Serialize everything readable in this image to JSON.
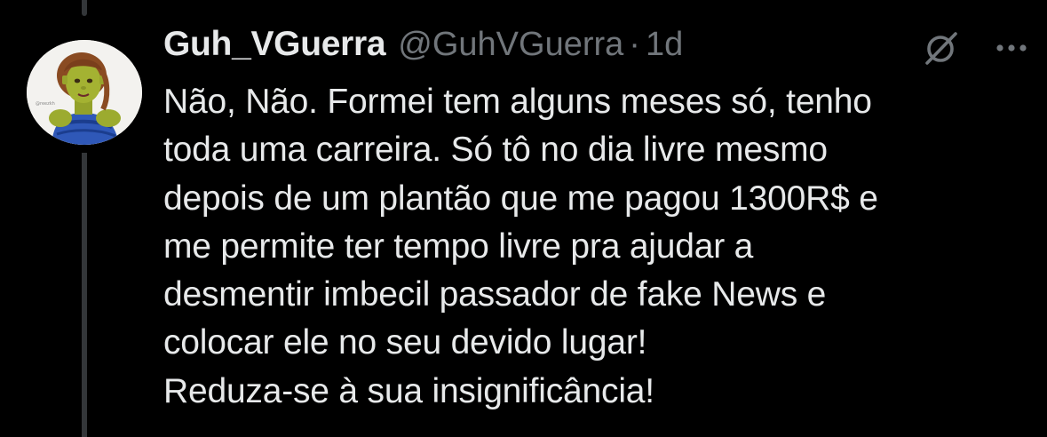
{
  "tweet": {
    "display_name": "Guh_VGuerra",
    "handle": "@GuhVGuerra",
    "separator": "·",
    "time": "1d",
    "lines": [
      "Não, Não. Formei tem alguns meses só, tenho",
      "toda uma carreira. Só tô no dia livre mesmo",
      "depois de um plantão que me pagou 1300R$ e",
      "me permite ter tempo livre pra ajudar a",
      "desmentir imbecil passador de fake News e",
      "colocar ele no seu devido lugar!",
      "Reduza-se à sua insignificância!"
    ]
  },
  "icons": {
    "avatar": "cartoon-ogress-avatar",
    "grok": "grok-icon",
    "more": "more-dots-icon"
  },
  "colors": {
    "background": "#000000",
    "text_primary": "#e7e9ea",
    "text_secondary": "#71767b",
    "thread_line": "#333639"
  }
}
